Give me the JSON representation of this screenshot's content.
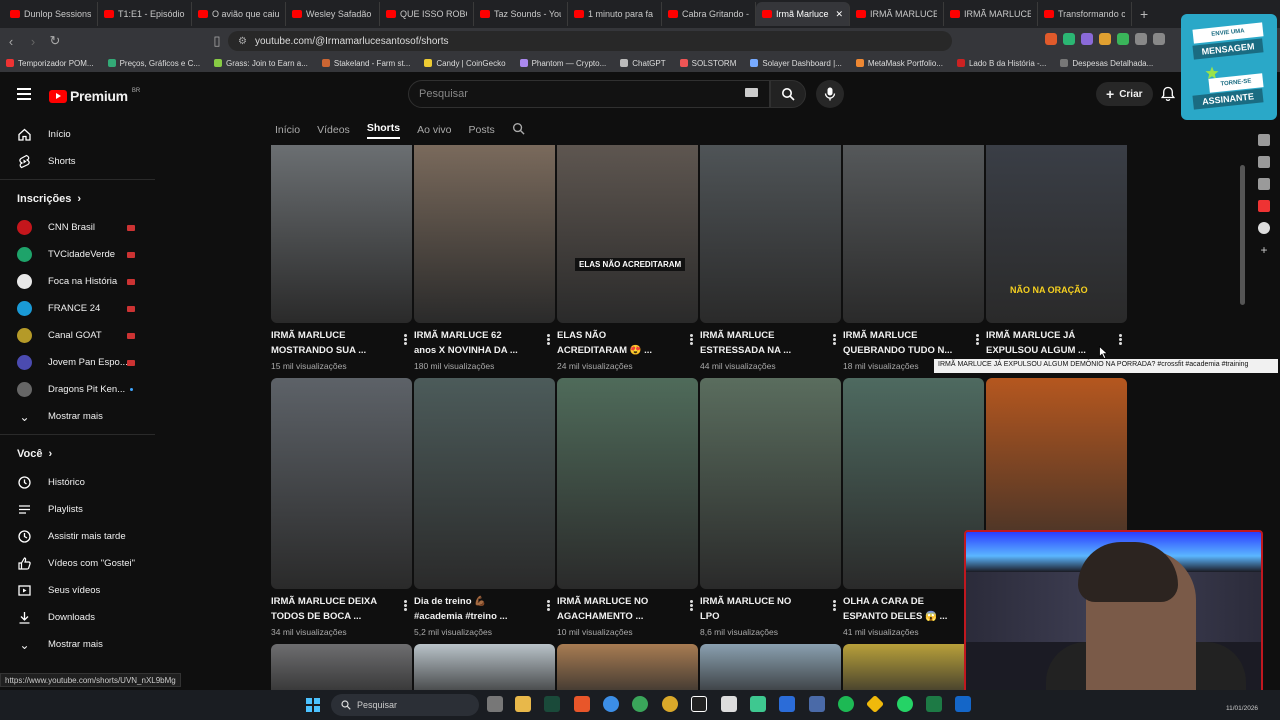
{
  "browser": {
    "tabs": [
      {
        "label": "Dunlop Sessions"
      },
      {
        "label": "T1:E1 - Episódio"
      },
      {
        "label": "O avião que caiu"
      },
      {
        "label": "Wesley Safadão c"
      },
      {
        "label": "QUE ISSO ROBCO"
      },
      {
        "label": "Taz Sounds - You"
      },
      {
        "label": "1 minuto para fa"
      },
      {
        "label": "Cabra Gritando -"
      },
      {
        "label": "Irmã Marluce"
      },
      {
        "label": "IRMÃ MARLUCE"
      },
      {
        "label": "IRMÃ MARLUCE"
      },
      {
        "label": "Transformando c"
      }
    ],
    "url": "youtube.com/@Irmamarlucesantosof/shorts",
    "bookmarks": [
      "Temporizador POM...",
      "Preços, Gráficos e C...",
      "Grass: Join to Earn a...",
      "Stakeland - Farm st...",
      "Candy | CoinGecko",
      "Phantom — Crypto...",
      "ChatGPT",
      "SOLSTORM",
      "Solayer Dashboard |...",
      "MetaMask Portfolio...",
      "Lado B da História -...",
      "Despesas Detalhada..."
    ],
    "status_url": "https://www.youtube.com/shorts/UVN_nXL9bMg"
  },
  "header": {
    "logo_text": "Premium",
    "region": "BR",
    "search_placeholder": "Pesquisar",
    "create_label": "Criar"
  },
  "sidebar": {
    "main": [
      {
        "label": "Início",
        "icon": "home-icon"
      },
      {
        "label": "Shorts",
        "icon": "shorts-icon"
      }
    ],
    "subscriptions_title": "Inscrições",
    "subscriptions": [
      {
        "label": "CNN Brasil",
        "color": "#c4161c"
      },
      {
        "label": "TVCidadeVerde",
        "color": "#1ea36a"
      },
      {
        "label": "Foca na História",
        "color": "#e8e8e8"
      },
      {
        "label": "FRANCE 24",
        "color": "#1a9ad6"
      },
      {
        "label": "Canal GOAT",
        "color": "#b59a28"
      },
      {
        "label": "Jovem Pan Espo...",
        "color": "#4b4bb0"
      },
      {
        "label": "Dragons Pit Ken...",
        "color": "#666666"
      }
    ],
    "show_more": "Mostrar mais",
    "you_title": "Você",
    "you_items": [
      {
        "label": "Histórico",
        "icon": "history-icon"
      },
      {
        "label": "Playlists",
        "icon": "playlists-icon"
      },
      {
        "label": "Assistir mais tarde",
        "icon": "watch-later-icon"
      },
      {
        "label": "Vídeos com \"Gostei\"",
        "icon": "like-icon"
      },
      {
        "label": "Seus vídeos",
        "icon": "your-videos-icon"
      },
      {
        "label": "Downloads",
        "icon": "download-icon"
      }
    ],
    "show_more_2": "Mostrar mais"
  },
  "channel_tabs": [
    "Início",
    "Vídeos",
    "Shorts",
    "Ao vivo",
    "Posts"
  ],
  "shorts": [
    {
      "title1": "IRMÃ MARLUCE",
      "title2": "MOSTRANDO SUA ...",
      "views": "15 mil visualizações",
      "bg": "#6b6f72"
    },
    {
      "title1": "IRMÃ MARLUCE 62",
      "title2": "anos X NOVINHA DA ...",
      "views": "180 mil visualizações",
      "bg": "#7a6a5c"
    },
    {
      "title1": "ELAS NÃO",
      "title2": "ACREDITARAM 😍 ...",
      "views": "24 mil visualizações",
      "bg": "#5e5650",
      "overlay": "ELAS NÃO ACREDITARAM"
    },
    {
      "title1": "IRMÃ MARLUCE",
      "title2": "ESTRESSADA NA ...",
      "views": "44 mil visualizações",
      "bg": "#4f5457"
    },
    {
      "title1": "IRMÃ MARLUCE",
      "title2": "QUEBRANDO TUDO N...",
      "views": "18 mil visualizações",
      "bg": "#55585a"
    },
    {
      "title1": "IRMÃ MARLUCE JÁ",
      "title2": "EXPULSOU ALGUM ...",
      "views": "",
      "bg": "#3a3e46",
      "overlay_yellow": "NÃO NA ORAÇÃO"
    },
    {
      "title1": "IRMÃ MARLUCE DEIXA",
      "title2": "TODOS DE BOCA ...",
      "views": "34 mil visualizações",
      "bg": "#5d6268"
    },
    {
      "title1": "Dia de treino 💪🏾",
      "title2": "#academia #treino ...",
      "views": "5,2 mil visualizações",
      "bg": "#4c5b5a"
    },
    {
      "title1": "IRMÃ MARLUCE NO",
      "title2": "AGACHAMENTO ...",
      "views": "10 mil visualizações",
      "bg": "#4f6b5a"
    },
    {
      "title1": "IRMÃ MARLUCE NO",
      "title2": "LPO",
      "views": "8,6 mil visualizações",
      "bg": "#5a6d5e"
    },
    {
      "title1": "OLHA A CARA DE",
      "title2": "ESPANTO DELES 😱 ...",
      "views": "41 mil visualizações",
      "bg": "#4e6a60"
    },
    {
      "title1": "",
      "title2": "",
      "views": "",
      "bg": "#b5571f"
    },
    {
      "title1": "",
      "title2": "",
      "views": "",
      "bg": "#6e6e70"
    },
    {
      "title1": "",
      "title2": "",
      "views": "",
      "bg": "#b9c3c9"
    },
    {
      "title1": "",
      "title2": "",
      "views": "",
      "bg": "#a87c52"
    },
    {
      "title1": "",
      "title2": "",
      "views": "",
      "bg": "#8aa0b0"
    },
    {
      "title1": "",
      "title2": "",
      "views": "",
      "bg": "#b8a03a"
    }
  ],
  "tooltip": "IRMÃ MARLUCE JÁ EXPULSOU ALGUM DEMÔNIO NA PORRADA? #crossfit #academia #training",
  "ad": {
    "line1": "ENVIE UMA",
    "line2": "MENSAGEM",
    "line3": "TORNE-SE",
    "line4": "ASSINANTE"
  },
  "taskbar": {
    "search": "Pesquisar",
    "date": "11/01/2026"
  }
}
